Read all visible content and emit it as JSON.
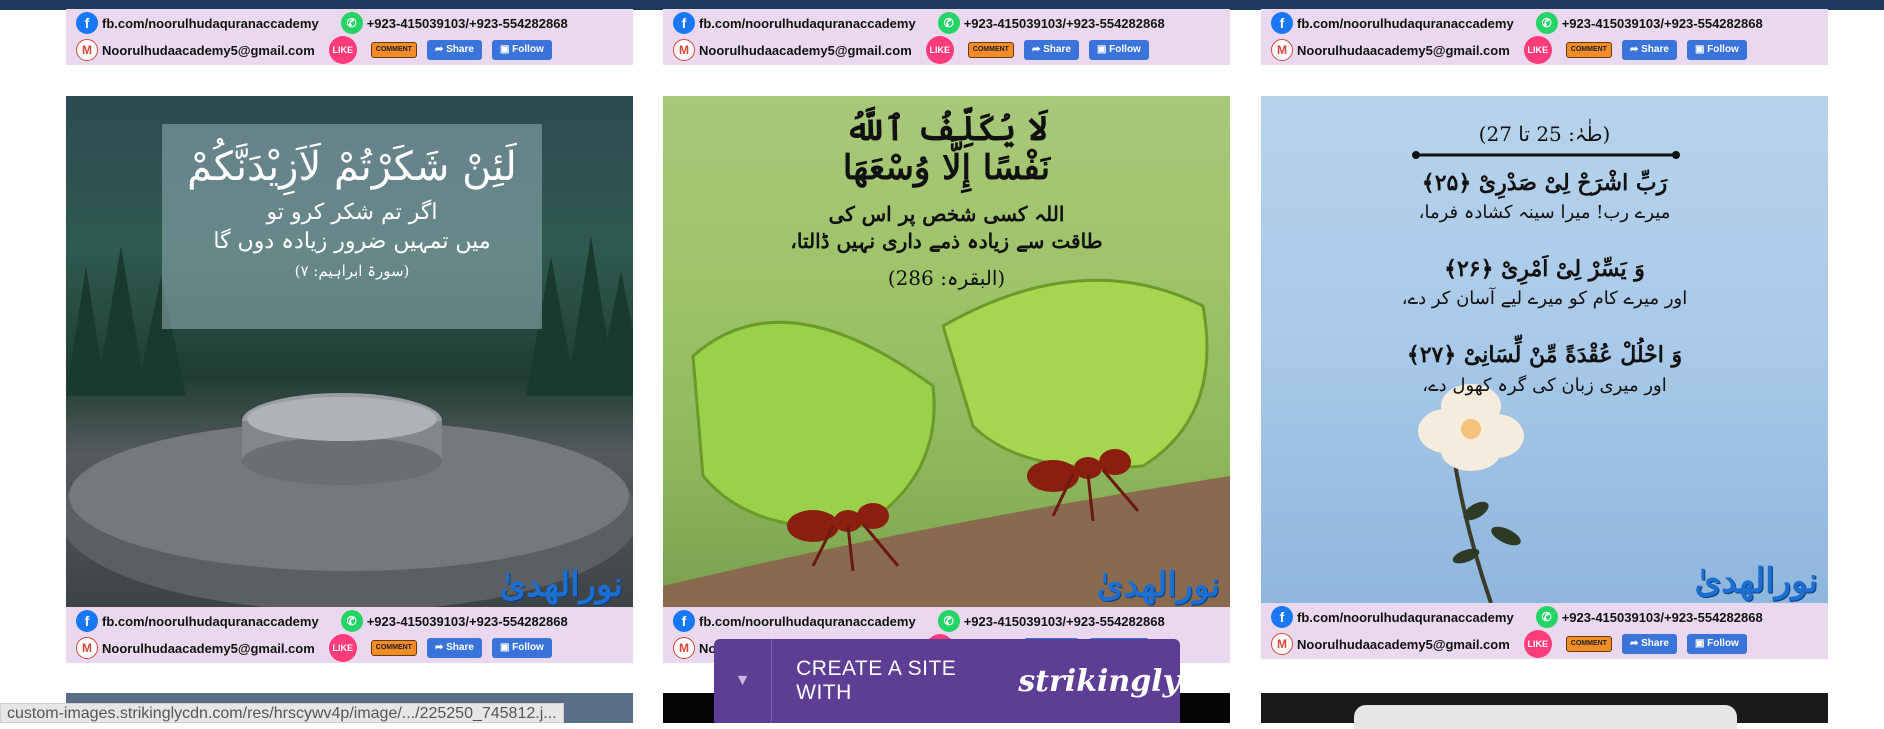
{
  "footer": {
    "fb": "fb.com/noorulhudaquranaccademy",
    "phone": "+923-415039103/+923-554282868",
    "email": "Noorulhudaacademy5@gmail.com",
    "like_label": "LIKE",
    "comment_label": "COMMENT",
    "share_label": "Share",
    "follow_label": "Follow"
  },
  "posts": [
    {
      "arabic": "لَئِنْ شَكَرْتُمْ لَاَزِيْدَنَّكُمْ",
      "urdu_1": "اگر تم شکر کرو تو",
      "urdu_2": "میں تمہیں ضرور زیادہ دوں گا",
      "ref": "(سورۃ ابراہیم: ۷)"
    },
    {
      "arabic_1": "لَا يُكَلِّفُ ٱللَّهُ",
      "arabic_2": "نَفْسًا إِلَّا وُسْعَهَا",
      "urdu_1": "اللہ کسی شخص پر اس کی",
      "urdu_2": "طاقت سے زیادہ ذمے داری نہیں ڈالتا،",
      "ref": "(البقرہ: 286)"
    },
    {
      "ref": "(طٰہٰ: 25 تا 27)",
      "a1": "رَبِّ اشْرَحْ لِیْ صَدْرِیْ ﴿۲۵﴾",
      "u1": "میرے رب! میرا سینہ کشادہ فرما،",
      "a2": "وَ یَسِّرْ لِیْ اَمْرِیْ ﴿۲۶﴾",
      "u2": "اور میرے کام کو میرے لیے آسان کر دے،",
      "a3": "وَ احْلُلْ عُقْدَةً مِّنْ لِّسَانِیْ ﴿۲۷﴾",
      "u3": "اور میری زبان کی گرہ کھول دے،"
    }
  ],
  "logo_text": "نورالھدیٰ",
  "status_url": "custom-images.strikinglycdn.com/res/hrscywv4p/image/.../225250_745812.j...",
  "strikingly": {
    "create": "CREATE A SITE WITH",
    "brand": "strikingly"
  },
  "icons": [
    "facebook-icon",
    "whatsapp-icon",
    "gmail-icon",
    "like-icon",
    "comment-icon",
    "share-icon",
    "follow-icon",
    "chevron-down-icon"
  ]
}
